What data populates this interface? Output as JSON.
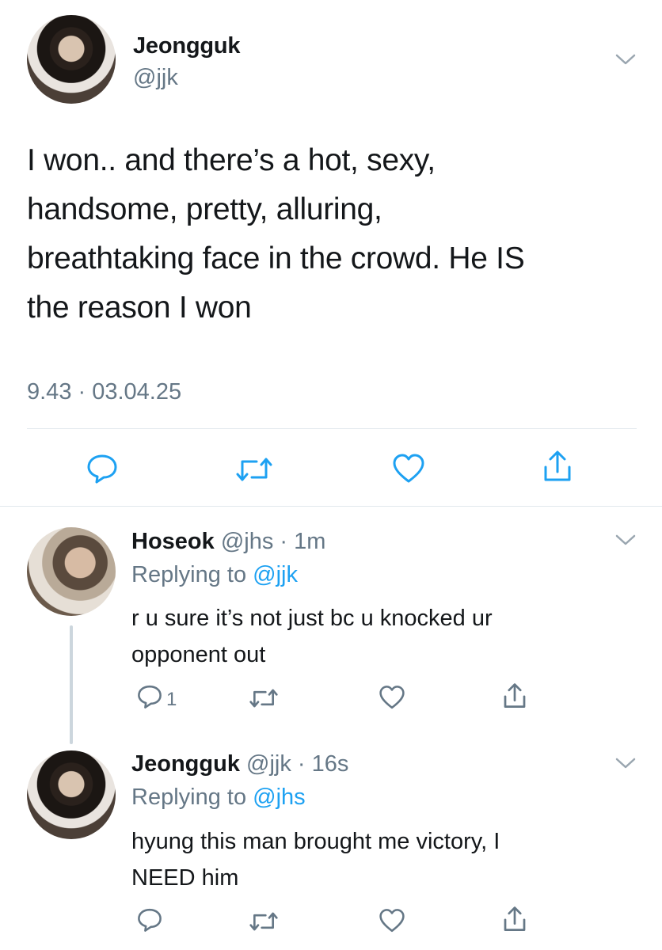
{
  "main_tweet": {
    "name": "Jeongguk",
    "handle": "@jjk",
    "text_lines": [
      "I won.. and there’s a hot, sexy,",
      "handsome, pretty, alluring,",
      "breathtaking face in the crowd. He IS",
      "the reason I won"
    ],
    "timestamp": "9.43 · 03.04.25",
    "actions": [
      "reply-icon",
      "retweet-icon",
      "like-icon",
      "share-icon"
    ]
  },
  "replies": [
    {
      "name": "Hoseok",
      "meta": "@jhs · 1m",
      "replying_prefix": "Replying to",
      "replying_to": "@jjk",
      "text_lines": [
        "r u sure it’s not just bc u knocked ur",
        "opponent out"
      ],
      "reply_count": "1"
    },
    {
      "name": "Jeongguk",
      "meta": "@jjk · 16s",
      "replying_prefix": "Replying to",
      "replying_to": "@jhs",
      "text_lines": [
        "hyung this man brought me victory, I",
        "NEED him"
      ],
      "reply_count": ""
    }
  ],
  "colors": {
    "text": "#14171a",
    "muted": "#657786",
    "link": "#1da1f2",
    "divider": "#e1e8ed",
    "thread_line": "#ccd6dd"
  }
}
